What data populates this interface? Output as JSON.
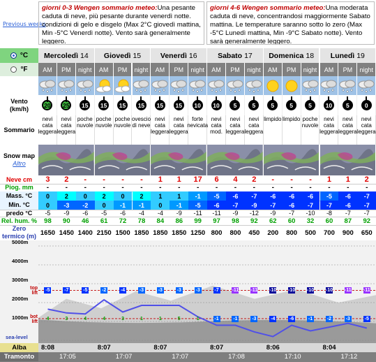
{
  "header": {
    "prev_link": "Previous weeks",
    "summary1": {
      "title": "giorni 0-3 Wengen sommario meteo:",
      "text": "Una pesante caduta di neve, più pesante durante venerdì notte. condizioni di gelo e disgelo (Max 2°C giovedì mattina, Min -5°C Venerdì notte). Vento sarà generalmente leggero."
    },
    "summary2": {
      "title": "giorni 4-6 Wengen sommario meteo:",
      "text": "Una moderata caduta di neve, concentrandosi maggiormente Sabato mattina. Le temperature saranno sotto lo zero (Max -5°C Lunedì mattina, Min -9°C Sabato notte). Vento sarà generalmente leggero."
    }
  },
  "units": {
    "celsius": "°C",
    "fahrenheit": "°F"
  },
  "days": [
    {
      "name": "Mercoledì",
      "num": "14",
      "periods": [
        "AM",
        "PM",
        "night"
      ]
    },
    {
      "name": "Giovedì",
      "num": "15",
      "periods": [
        "AM",
        "PM",
        "night"
      ]
    },
    {
      "name": "Venerdì",
      "num": "16",
      "periods": [
        "AM",
        "PM",
        "night"
      ]
    },
    {
      "name": "Sabato",
      "num": "17",
      "periods": [
        "AM",
        "PM",
        "night"
      ]
    },
    {
      "name": "Domenica",
      "num": "18",
      "periods": [
        "AM",
        "PM",
        "night"
      ]
    },
    {
      "name": "Lunedì",
      "num": "19",
      "periods": [
        "AM",
        "PM",
        "night"
      ]
    }
  ],
  "labels": {
    "vento": "Vento",
    "vento_unit": "(km/h)",
    "sommario": "Sommario",
    "snowmap": "Snow map",
    "altro": "Altro",
    "neve": "Neve cm",
    "piog": "Piog. mm",
    "mass": "Mass. °C",
    "min": "Min. °C",
    "predo": "predo °C",
    "rel": "Rel. hum. %",
    "zero": "Zero",
    "zero2": "termico (m)",
    "alba": "Alba",
    "tramonto": "Tramonto"
  },
  "sky_icons": [
    "cloud-snow-icon",
    "cloud-snow-icon",
    "cloud-snow-icon",
    "sun-cloud-icon",
    "sun-cloud-icon",
    "cloud-snow-icon",
    "cloud-snow-icon",
    "cloud-snow-icon",
    "cloud-snow-icon",
    "cloud-snow-icon",
    "cloud-snow-icon",
    "cloud-snow-icon",
    "sun-icon",
    "sun-icon",
    "cloud-snow-icon",
    "cloud-snow-icon",
    "cloud-snow-icon",
    "cloud-snow-icon"
  ],
  "wind": [
    "20",
    "25",
    "15",
    "15",
    "15",
    "15",
    "15",
    "15",
    "10",
    "10",
    "5",
    "5",
    "5",
    "5",
    "5",
    "10",
    "5",
    "0"
  ],
  "wind_green": [
    true,
    true,
    false,
    false,
    false,
    false,
    false,
    false,
    false,
    false,
    false,
    false,
    false,
    false,
    false,
    false,
    false,
    false
  ],
  "summary": [
    "nevi cata leggera",
    "nevi cata leggera",
    "poche nuvole",
    "poche nuvole",
    "poche nuvole",
    "ovescio di neve",
    "nevi cata leggera",
    "nevi cata leggera",
    "forte nevicata",
    "nevi cata mod.",
    "nevi cata leggera",
    "nevi cata leggera",
    "limpido",
    "limpido",
    "poche nuvole",
    "nevi cata leggera",
    "nevi cata leggera",
    "nevi cata leggera"
  ],
  "neve": [
    "3",
    "2",
    "-",
    "-",
    "-",
    "-",
    "1",
    "1",
    "17",
    "6",
    "4",
    "2",
    "-",
    "-",
    "-",
    "1",
    "1",
    "2"
  ],
  "piog": [
    "-",
    "-",
    "-",
    "-",
    "-",
    "-",
    "-",
    "-",
    "-",
    "-",
    "-",
    "-",
    "-",
    "-",
    "-",
    "-",
    "-",
    "-"
  ],
  "mass": [
    "0",
    "2",
    "0",
    "2",
    "0",
    "2",
    "1",
    "1",
    "-1",
    "-5",
    "-6",
    "-7",
    "-6",
    "-6",
    "-6",
    "-5",
    "-6",
    "-7"
  ],
  "min": [
    "0",
    "-3",
    "-2",
    "0",
    "-1",
    "-1",
    "0",
    "-1",
    "-5",
    "-6",
    "-7",
    "-9",
    "-7",
    "-6",
    "-7",
    "-7",
    "-6",
    "-7"
  ],
  "predo": [
    "-5",
    "-9",
    "-6",
    "-5",
    "-6",
    "-4",
    "-4",
    "-9",
    "-11",
    "-11",
    "-9",
    "-12",
    "-9",
    "-7",
    "-10",
    "-8",
    "-7",
    "-7"
  ],
  "rel": [
    "98",
    "90",
    "46",
    "61",
    "72",
    "78",
    "84",
    "86",
    "99",
    "97",
    "98",
    "92",
    "62",
    "60",
    "32",
    "60",
    "87",
    "92"
  ],
  "zero": [
    "1650",
    "1450",
    "1400",
    "2150",
    "1500",
    "1850",
    "1850",
    "1850",
    "1250",
    "800",
    "800",
    "450",
    "200",
    "800",
    "500",
    "700",
    "900",
    "650"
  ],
  "chart": {
    "y_labels": [
      "5000m",
      "4000m",
      "3000m",
      "2000m",
      "1000m",
      "sea-level"
    ],
    "top_lift": "top lift",
    "bot_lift": "bot lift",
    "top_temps": [
      "-5",
      "-7",
      "-5",
      "-2",
      "-4",
      "-3",
      "-3",
      "-3",
      "-3",
      "-7",
      "-11",
      "-11",
      "-10",
      "-10",
      "-10",
      "-10",
      "-11",
      "-11"
    ],
    "bot_temps": [
      "4",
      "3",
      "4",
      "4",
      "3",
      "1",
      "1",
      "5",
      "1",
      "-1",
      "-1",
      "-3",
      "-4",
      "-6",
      "-1",
      "-2",
      "-3",
      "-5"
    ],
    "freezing_m": [
      1650,
      1450,
      1400,
      2150,
      1500,
      1850,
      1850,
      1850,
      1250,
      800,
      800,
      450,
      200,
      800,
      500,
      700,
      900,
      650
    ]
  },
  "alba": [
    "8:08",
    "8:07",
    "8:07",
    "8:07",
    "8:06",
    "8:04"
  ],
  "tramonto": [
    "17:05",
    "17:07",
    "17:07",
    "17:08",
    "17:10",
    "17:12"
  ]
}
